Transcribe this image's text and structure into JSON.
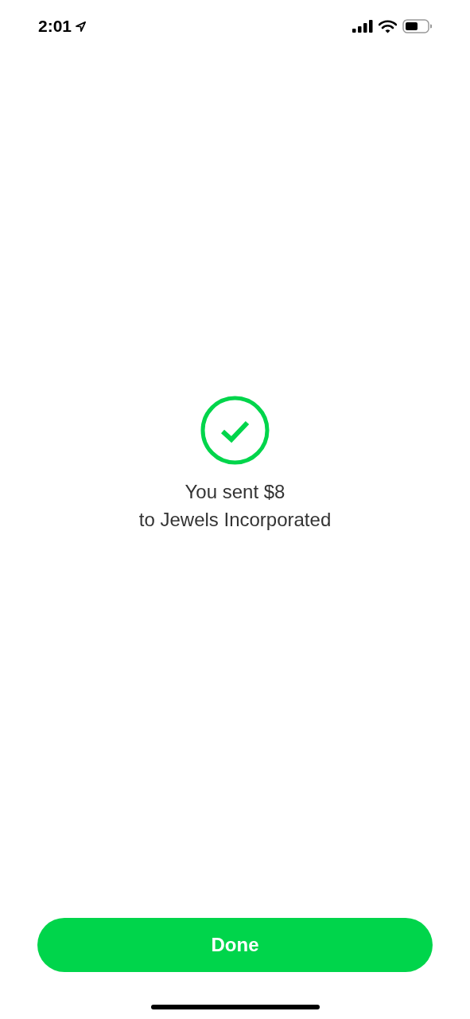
{
  "status_bar": {
    "time": "2:01"
  },
  "confirmation": {
    "line_1": "You sent $8",
    "line_2": "to Jewels Incorporated"
  },
  "done_button": {
    "label": "Done"
  }
}
